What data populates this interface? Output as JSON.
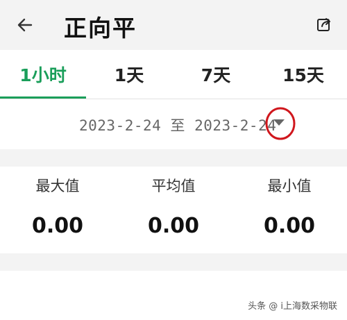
{
  "header": {
    "title": "正向平"
  },
  "tabs": [
    {
      "label": "1小时",
      "active": true
    },
    {
      "label": "1天",
      "active": false
    },
    {
      "label": "7天",
      "active": false
    },
    {
      "label": "15天",
      "active": false
    }
  ],
  "date_range": {
    "text": "2023-2-24 至 2023-2-24"
  },
  "stats": [
    {
      "label": "最大值",
      "value": "0.00"
    },
    {
      "label": "平均值",
      "value": "0.00"
    },
    {
      "label": "最小值",
      "value": "0.00"
    }
  ],
  "watermark": "头条 @ i上海数采物联",
  "colors": {
    "accent": "#1a9e5a",
    "annotation": "#d0171d"
  },
  "icons": {
    "back": "arrow-left-icon",
    "share": "share-icon",
    "dropdown": "triangle-down-icon"
  }
}
